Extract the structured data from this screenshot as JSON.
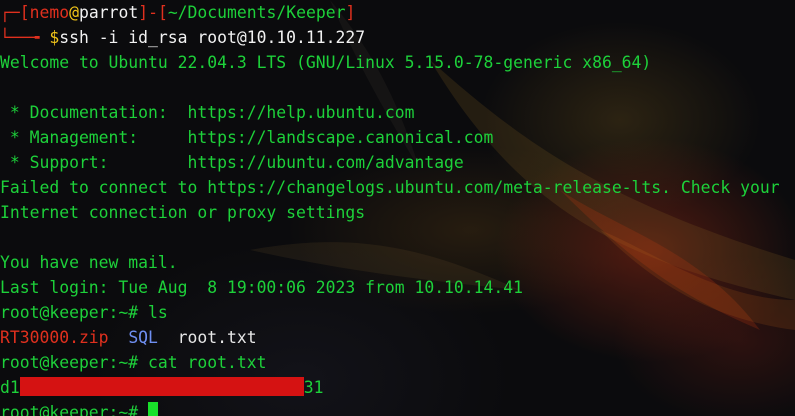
{
  "prompt_header": {
    "box_corner": "┌─",
    "user": "nemo",
    "at": "@",
    "host": "parrot",
    "separator": "]-[",
    "open_bracket": "[",
    "path": "~/Documents/Keeper",
    "close_bracket": "]"
  },
  "prompt_command": {
    "box_corner": "└──╼ ",
    "dollar": "$",
    "command": "ssh -i id_rsa root@10.10.11.227"
  },
  "motd": {
    "welcome": "Welcome to Ubuntu 22.04.3 LTS (GNU/Linux 5.15.0-78-generic x86_64)",
    "blank1": "",
    "documentation": " * Documentation:  https://help.ubuntu.com",
    "management": " * Management:     https://landscape.canonical.com",
    "support": " * Support:        https://ubuntu.com/advantage",
    "failed1": "Failed to connect to https://changelogs.ubuntu.com/meta-release-lts. Check your",
    "failed2": "Internet connection or proxy settings",
    "blank2": "",
    "mail": "You have new mail.",
    "last_login": "Last login: Tue Aug  8 19:00:06 2023 from 10.10.14.41"
  },
  "session": {
    "prompt1": "root@keeper:~# ",
    "cmd1": "ls",
    "ls_items": [
      {
        "name": "RT30000.zip",
        "type": "archive"
      },
      {
        "name": "SQL",
        "type": "directory"
      },
      {
        "name": "root.txt",
        "type": "file"
      }
    ],
    "prompt2": "root@keeper:~# ",
    "cmd2": "cat root.txt",
    "flag_prefix": "d1",
    "flag_suffix": "31",
    "prompt3": "root@keeper:~# "
  },
  "colors": {
    "prompt_red": "#e0301e",
    "green_text": "#1dd13a",
    "directory_blue": "#6f8ff2",
    "redaction": "#d51212",
    "cursor": "#19e02a"
  }
}
